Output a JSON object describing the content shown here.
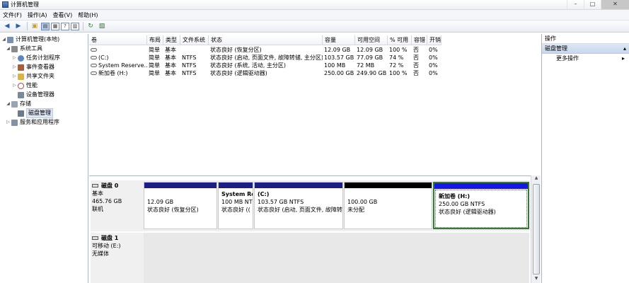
{
  "window": {
    "title": "计算机管理",
    "controls": [
      "–",
      "□",
      "✕"
    ]
  },
  "menu": [
    "文件(F)",
    "操作(A)",
    "查看(V)",
    "帮助(H)"
  ],
  "toolbar": [
    "back-icon",
    "forward-icon",
    "up-folder-icon",
    "show-tree-icon",
    "properties-icon",
    "help-icon",
    "refresh-icon",
    "export-icon"
  ],
  "tree": {
    "root": "计算机管理(本地)",
    "system_tools": "系统工具",
    "task_scheduler": "任务计划程序",
    "event_viewer": "事件查看器",
    "shared_folders": "共享文件夹",
    "performance": "性能",
    "device_manager": "设备管理器",
    "storage": "存储",
    "disk_management": "磁盘管理",
    "services": "服务和应用程序"
  },
  "volumes": {
    "headers": [
      "卷",
      "布局",
      "类型",
      "文件系统",
      "状态",
      "容量",
      "可用空间",
      "% 可用",
      "容错",
      "开销"
    ],
    "rows": [
      [
        "",
        "简单",
        "基本",
        "",
        "状态良好 (恢复分区)",
        "12.09 GB",
        "12.09 GB",
        "100 %",
        "否",
        "0%"
      ],
      [
        "(C:)",
        "简单",
        "基本",
        "NTFS",
        "状态良好 (启动, 页面文件, 故障转储, 主分区)",
        "103.57 GB",
        "77.09 GB",
        "74 %",
        "否",
        "0%"
      ],
      [
        "System Reserve...",
        "简单",
        "基本",
        "NTFS",
        "状态良好 (系统, 活动, 主分区)",
        "100 MB",
        "72 MB",
        "72 %",
        "否",
        "0%"
      ],
      [
        "新加卷 (H:)",
        "简单",
        "基本",
        "NTFS",
        "状态良好 (逻辑驱动器)",
        "250.00 GB",
        "249.90 GB",
        "100 %",
        "否",
        "0%"
      ]
    ]
  },
  "actions": {
    "header": "操作",
    "section": "磁盘管理",
    "more": "更多操作"
  },
  "disks": [
    {
      "name": "磁盘 0",
      "type": "基本",
      "size": "465.76 GB",
      "status": "联机",
      "partitions": [
        {
          "title": "",
          "line1": "12.09 GB",
          "line2": "状态良好 (恢复分区)"
        },
        {
          "title": "System Re",
          "line1": "100 MB NT",
          "line2": "状态良好 (("
        },
        {
          "title": "(C:)",
          "line1": "103.57 GB NTFS",
          "line2": "状态良好 (启动, 页面文件, 故障转储"
        },
        {
          "title": "",
          "line1": "100.00 GB",
          "line2": "未分配"
        },
        {
          "title": "新加卷 (H:)",
          "line1": "250.00 GB NTFS",
          "line2": "状态良好 (逻辑驱动器)"
        }
      ]
    },
    {
      "name": "磁盘 1",
      "type": "可移动 (E:)",
      "size": "",
      "status": "无媒体"
    }
  ]
}
